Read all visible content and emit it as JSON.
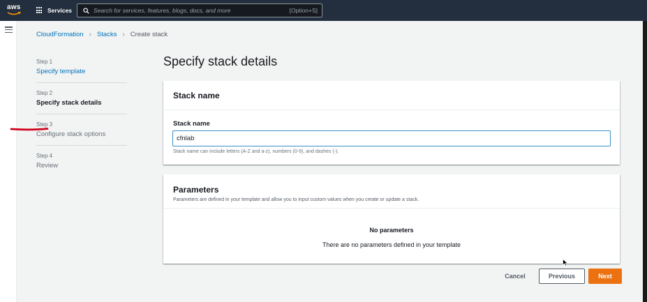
{
  "nav": {
    "logo_text": "aws",
    "services_label": "Services",
    "search_placeholder": "Search for services, features, blogs, docs, and more",
    "search_shortcut": "[Option+S]"
  },
  "breadcrumb": {
    "items": [
      "CloudFormation",
      "Stacks"
    ],
    "current": "Create stack"
  },
  "steps": [
    {
      "number": "Step 1",
      "label": "Specify template",
      "state": "link"
    },
    {
      "number": "Step 2",
      "label": "Specify stack details",
      "state": "active"
    },
    {
      "number": "Step 3",
      "label": "Configure stack options",
      "state": "muted"
    },
    {
      "number": "Step 4",
      "label": "Review",
      "state": "muted"
    }
  ],
  "page_title": "Specify stack details",
  "stack_name_panel": {
    "header": "Stack name",
    "field_label": "Stack name",
    "value": "cfnlab",
    "hint": "Stack name can include letters (A-Z and a-z), numbers (0-9), and dashes (-)."
  },
  "parameters_panel": {
    "header": "Parameters",
    "description": "Parameters are defined in your template and allow you to input custom values when you create or update a stack.",
    "empty_title": "No parameters",
    "empty_text": "There are no parameters defined in your template"
  },
  "actions": {
    "cancel": "Cancel",
    "previous": "Previous",
    "next": "Next"
  },
  "colors": {
    "nav_bg": "#232f3e",
    "link": "#0073bb",
    "primary": "#ec7211",
    "annotation": "#d0021b"
  },
  "icons": [
    "aws-logo",
    "grid-icon",
    "search-icon",
    "hamburger-icon",
    "chevron-right-icon",
    "cursor-icon"
  ]
}
